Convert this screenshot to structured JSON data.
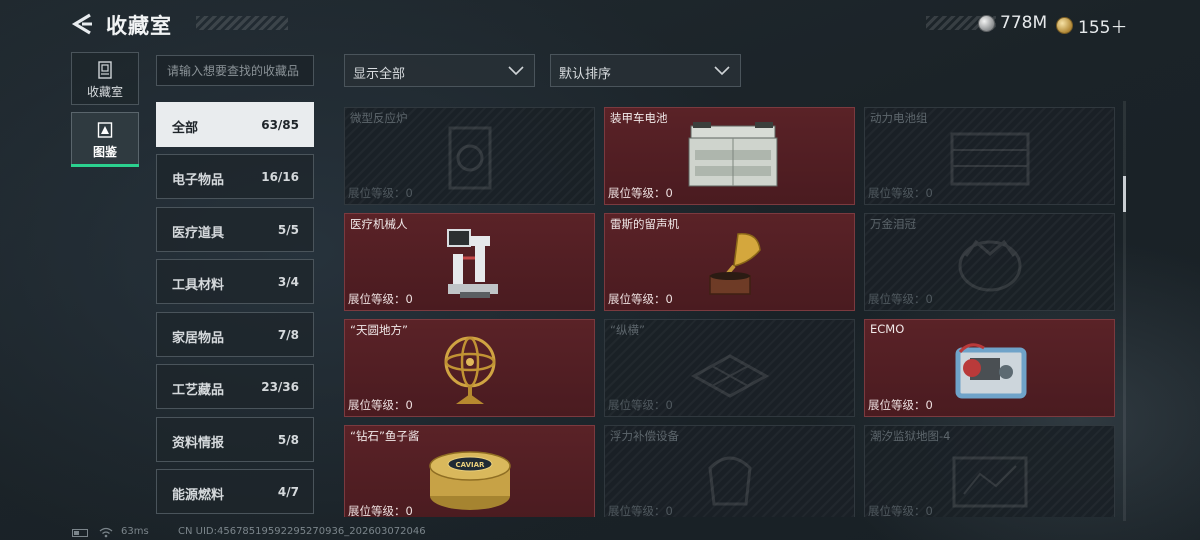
{
  "header": {
    "title": "收藏室",
    "currency_silver": "778M",
    "currency_gold": "155＋"
  },
  "side_tabs": [
    {
      "label": "收藏室",
      "icon": "collection-room-icon",
      "active": false
    },
    {
      "label": "图鉴",
      "icon": "codex-icon",
      "active": true
    }
  ],
  "search": {
    "placeholder": "请输入想要查找的收藏品"
  },
  "filters": {
    "display": "显示全部",
    "sort": "默认排序"
  },
  "categories": [
    {
      "name": "全部",
      "count": "63/85",
      "active": true
    },
    {
      "name": "电子物品",
      "count": "16/16"
    },
    {
      "name": "医疗道具",
      "count": "5/5"
    },
    {
      "name": "工具材料",
      "count": "3/4"
    },
    {
      "name": "家居物品",
      "count": "7/8"
    },
    {
      "name": "工艺藏品",
      "count": "23/36"
    },
    {
      "name": "资料情报",
      "count": "5/8"
    },
    {
      "name": "能源燃料",
      "count": "4/7"
    }
  ],
  "items": [
    {
      "name": "微型反应炉",
      "level": "展位等级：0",
      "owned": false,
      "icon": "reactor-icon"
    },
    {
      "name": "装甲车电池",
      "level": "展位等级：0",
      "owned": true,
      "icon": "battery-icon"
    },
    {
      "name": "动力电池组",
      "level": "展位等级：0",
      "owned": false,
      "icon": "battery-pack-icon"
    },
    {
      "name": "医疗机械人",
      "level": "展位等级：0",
      "owned": true,
      "icon": "medical-robot-icon"
    },
    {
      "name": "雷斯的留声机",
      "level": "展位等级：0",
      "owned": true,
      "icon": "gramophone-icon"
    },
    {
      "name": "万金泪冠",
      "level": "展位等级：0",
      "owned": false,
      "icon": "crown-icon"
    },
    {
      "name": "“天圆地方”",
      "level": "展位等级：0",
      "owned": true,
      "icon": "armillary-sphere-icon"
    },
    {
      "name": "“纵横”",
      "level": "展位等级：0",
      "owned": false,
      "icon": "chessboard-icon"
    },
    {
      "name": "ECMO",
      "level": "展位等级：0",
      "owned": true,
      "icon": "ecmo-machine-icon"
    },
    {
      "name": "“钻石”鱼子酱",
      "level": "展位等级：0",
      "owned": true,
      "icon": "caviar-tin-icon"
    },
    {
      "name": "浮力补偿设备",
      "level": "展位等级：0",
      "owned": false,
      "icon": "buoyancy-device-icon"
    },
    {
      "name": "潮汐监狱地图-4",
      "level": "展位等级：0",
      "owned": false,
      "icon": "map-icon"
    }
  ],
  "caviar_label": "CAVIAR",
  "status": {
    "ping": "63ms",
    "uid": "CN UID:45678519592295270936_202603072046"
  },
  "colors": {
    "accent": "#2bd18f",
    "owned_card": "#521f24"
  }
}
